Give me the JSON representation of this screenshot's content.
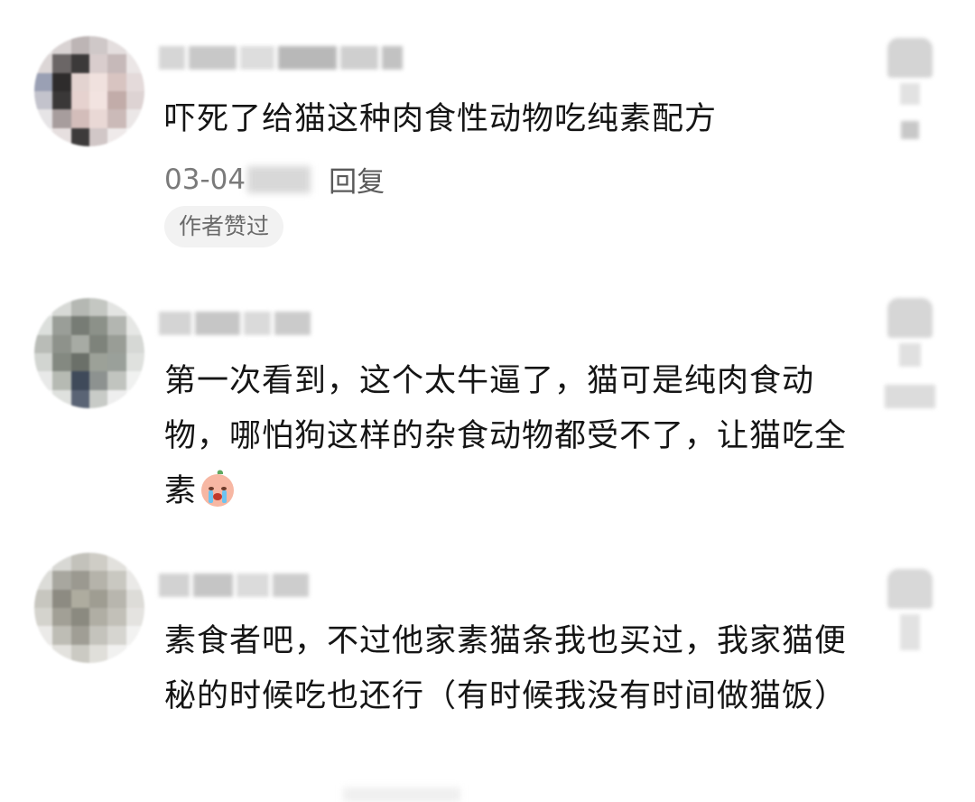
{
  "comments": [
    {
      "text": "吓死了给猫这种肉食性动物吃纯素配方",
      "date": "03-04",
      "reply_label": "回复",
      "badge": "作者赞过"
    },
    {
      "text": "第一次看到，这个太牛逼了，猫可是纯肉食动物，哪怕狗这样的杂食动物都受不了，让猫吃全素",
      "emoji_name": "crying-face-icon"
    },
    {
      "text": "素食者吧，不过他家素猫条我也买过，我家猫便秘的时候吃也还行（有时候我没有时间做猫饭）"
    }
  ]
}
